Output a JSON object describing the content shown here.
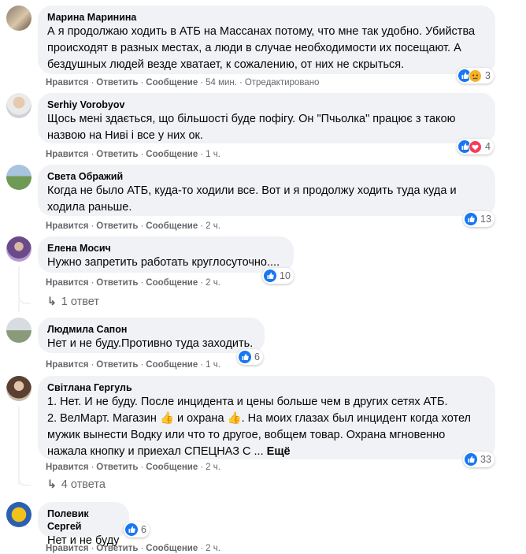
{
  "actions": {
    "like": "Нравится",
    "reply": "Ответить",
    "message": "Сообщение",
    "dot": "·"
  },
  "comments": [
    {
      "author": "Марина Маринина",
      "lines": [
        "А я продолжаю ходить в АТБ на Массанах потому, что мне так удобно. Убийства",
        "происходят в разных местах, а люди в случае необходимости их посещают. А",
        "бездушных людей везде хватает, к сожалению, от них не скрыться."
      ],
      "time": "54 мин.",
      "edited": "Отредактировано",
      "reactions": [
        "like-icon",
        "sad-icon"
      ],
      "count": "3"
    },
    {
      "author": "Serhiy Vorobyov",
      "lines": [
        "Щось мені здається, що більшості буде пофігу. Он \"Пчьолка\" працює з такою",
        "назвою на Ниві і все у них ок."
      ],
      "time": "1 ч.",
      "reactions": [
        "like-icon",
        "heart-icon"
      ],
      "count": "4"
    },
    {
      "author": "Света Ображий",
      "lines": [
        "Когда не было АТБ, куда-то ходили все. Вот и я продолжу ходить туда куда и",
        "ходила раньше."
      ],
      "time": "2 ч.",
      "reactions": [
        "like-icon"
      ],
      "count": "13"
    },
    {
      "author": "Елена Мосич",
      "lines": [
        "Нужно запретить работать круглосуточно...."
      ],
      "time": "2 ч.",
      "reactions": [
        "like-icon"
      ],
      "count": "10",
      "replies": "1 ответ"
    },
    {
      "author": "Людмила Сапон",
      "lines": [
        "Нет и не буду.Противно туда заходить."
      ],
      "time": "1 ч.",
      "reactions": [
        "like-icon"
      ],
      "count": "6"
    },
    {
      "author": "Світлана Гергуль",
      "lines": [
        "1. Нет. И не буду. После инцидента и цены больше чем в других сетях АТБ.",
        "2. ВелМарт. Магазин 👍 и охрана 👍. На моих глазах был инцидент когда хотел",
        "мужик вынести Водку или что то другое, вобщем товар. Охрана мгновенно",
        "нажала кнопку и приехал СПЕЦНАЗ С ..."
      ],
      "more": "Ещё",
      "time": "2 ч.",
      "reactions": [
        "like-icon"
      ],
      "count": "33",
      "replies": "4 ответа"
    },
    {
      "author": "Полевик Сергей",
      "lines": [
        "Нет и не буду"
      ],
      "time": "2 ч.",
      "reactions": [
        "like-icon"
      ],
      "count": "6"
    }
  ],
  "colors": {
    "like": "#1877f2",
    "heart": "#f33e58",
    "sad": "#f7b125",
    "bubble": "#f0f2f5",
    "meta": "#65676b"
  }
}
